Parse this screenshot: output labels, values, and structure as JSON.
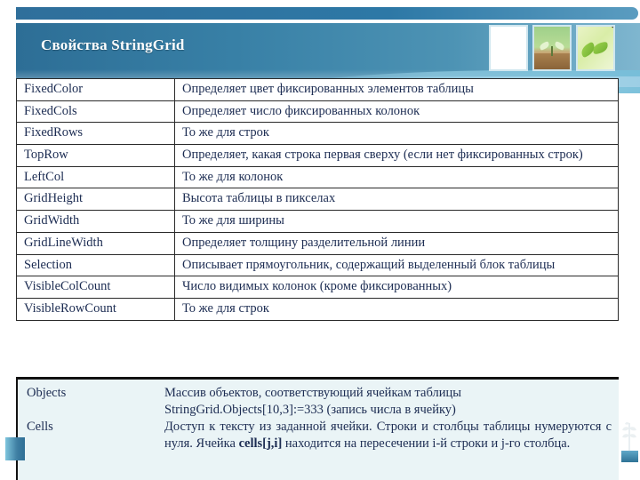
{
  "slide": {
    "title": "Свойства StringGrid",
    "accent_color": "#2d6e96",
    "accent_light": "#7fb6cf",
    "text_color": "#1c2c52",
    "bottom_block_bg": "#eaf4f6"
  },
  "thumbnails": [
    {
      "name": "blank-thumbnail",
      "caption": ""
    },
    {
      "name": "sprout-photo-thumbnail",
      "caption": ""
    },
    {
      "name": "leaves-photo-thumbnail",
      "caption": ""
    }
  ],
  "table": {
    "rows": [
      {
        "name": "FixedColor",
        "desc": "Определяет цвет фиксированных элементов таблицы"
      },
      {
        "name": "FixedCols",
        "desc": "Определяет число фиксированных колонок"
      },
      {
        "name": "FixedRows",
        "desc": "То же для строк"
      },
      {
        "name": "TopRow",
        "desc": "Определяет, какая строка первая сверху (если нет фиксированных строк)"
      },
      {
        "name": "LeftCol",
        "desc": "То же для колонок"
      },
      {
        "name": "GridHeight",
        "desc": "Высота таблицы в пикселах"
      },
      {
        "name": "GridWidth",
        "desc": "То же для ширины"
      },
      {
        "name": "GridLineWidth",
        "desc": "Определяет толщину разделительной линии"
      },
      {
        "name": "Selection",
        "desc": "Описывает прямоугольник, содержащий выделенный блок таблицы"
      },
      {
        "name": "VisibleColCount",
        "desc": "Число видимых колонок (кроме фиксированных)"
      },
      {
        "name": "VisibleRowCount",
        "desc": "То же для строк"
      }
    ]
  },
  "bottom_block": {
    "rows": [
      {
        "name": "Objects",
        "desc_line1": "Массив объектов, соответствующий ячейкам таблицы",
        "desc_line2": "StringGrid.Objects[10,3]:=333 (запись числа в ячейку)"
      },
      {
        "name": "Cells",
        "desc_part1": "Доступ к тексту из заданной ячейки. Строки и столбцы таблицы нумеруются с нуля. Ячейка ",
        "desc_bold": "cells[j,i]",
        "desc_part2": " находится на пересечении i-й строки и j-го столбца."
      }
    ]
  }
}
